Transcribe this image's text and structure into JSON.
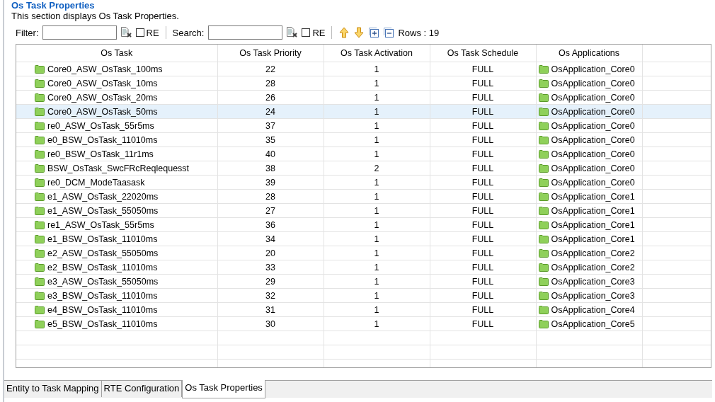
{
  "section": {
    "title": "Os Task Properties",
    "description": "This section displays Os Task Properties."
  },
  "toolbar": {
    "filter_label": "Filter:",
    "filter_re": {
      "label": "RE",
      "checked": false
    },
    "search_label": "Search:",
    "search_re": {
      "label": "RE",
      "checked": false
    },
    "rows": "Rows : 19"
  },
  "table": {
    "columns": [
      "Os Task",
      "Os Task Priority",
      "Os Task Activation",
      "Os Task Schedule",
      "Os Applications"
    ],
    "rows": [
      {
        "task": "Core0_ASW_OsTask_100ms",
        "priority": "22",
        "activation": "1",
        "schedule": "FULL",
        "application": "OsApplication_Core0",
        "selected": false
      },
      {
        "task": "Core0_ASW_OsTask_10ms",
        "priority": "28",
        "activation": "1",
        "schedule": "FULL",
        "application": "OsApplication_Core0",
        "selected": false
      },
      {
        "task": "Core0_ASW_OsTask_20ms",
        "priority": "26",
        "activation": "1",
        "schedule": "FULL",
        "application": "OsApplication_Core0",
        "selected": false
      },
      {
        "task": "Core0_ASW_OsTask_50ms",
        "priority": "24",
        "activation": "1",
        "schedule": "FULL",
        "application": "OsApplication_Core0",
        "selected": true
      },
      {
        "task": "re0_ASW_OsTask_55r5ms",
        "priority": "37",
        "activation": "1",
        "schedule": "FULL",
        "application": "OsApplication_Core0",
        "selected": false
      },
      {
        "task": "e0_BSW_OsTask_11010ms",
        "priority": "35",
        "activation": "1",
        "schedule": "FULL",
        "application": "OsApplication_Core0",
        "selected": false
      },
      {
        "task": "re0_BSW_OsTask_11r1ms",
        "priority": "40",
        "activation": "1",
        "schedule": "FULL",
        "application": "OsApplication_Core0",
        "selected": false
      },
      {
        "task": "BSW_OsTask_SwcFRcReqlequesst",
        "priority": "38",
        "activation": "2",
        "schedule": "FULL",
        "application": "OsApplication_Core0",
        "selected": false
      },
      {
        "task": "re0_DCM_ModeTaasask",
        "priority": "39",
        "activation": "1",
        "schedule": "FULL",
        "application": "OsApplication_Core0",
        "selected": false
      },
      {
        "task": "e1_ASW_OsTask_22020ms",
        "priority": "28",
        "activation": "1",
        "schedule": "FULL",
        "application": "OsApplication_Core1",
        "selected": false
      },
      {
        "task": "e1_ASW_OsTask_55050ms",
        "priority": "27",
        "activation": "1",
        "schedule": "FULL",
        "application": "OsApplication_Core1",
        "selected": false
      },
      {
        "task": "re1_ASW_OsTask_55r5ms",
        "priority": "36",
        "activation": "1",
        "schedule": "FULL",
        "application": "OsApplication_Core1",
        "selected": false
      },
      {
        "task": "e1_BSW_OsTask_11010ms",
        "priority": "34",
        "activation": "1",
        "schedule": "FULL",
        "application": "OsApplication_Core1",
        "selected": false
      },
      {
        "task": "e2_ASW_OsTask_55050ms",
        "priority": "20",
        "activation": "1",
        "schedule": "FULL",
        "application": "OsApplication_Core2",
        "selected": false
      },
      {
        "task": "e2_BSW_OsTask_11010ms",
        "priority": "33",
        "activation": "1",
        "schedule": "FULL",
        "application": "OsApplication_Core2",
        "selected": false
      },
      {
        "task": "e3_ASW_OsTask_55050ms",
        "priority": "29",
        "activation": "1",
        "schedule": "FULL",
        "application": "OsApplication_Core3",
        "selected": false
      },
      {
        "task": "e3_BSW_OsTask_11010ms",
        "priority": "32",
        "activation": "1",
        "schedule": "FULL",
        "application": "OsApplication_Core3",
        "selected": false
      },
      {
        "task": "e4_BSW_OsTask_11010ms",
        "priority": "31",
        "activation": "1",
        "schedule": "FULL",
        "application": "OsApplication_Core4",
        "selected": false
      },
      {
        "task": "e5_BSW_OsTask_11010ms",
        "priority": "30",
        "activation": "1",
        "schedule": "FULL",
        "application": "OsApplication_Core5",
        "selected": false
      }
    ]
  },
  "tabs": [
    {
      "label": "Entity to Task Mapping",
      "selected": false
    },
    {
      "label": "RTE Configuration",
      "selected": false
    },
    {
      "label": "Os Task Properties",
      "selected": true
    }
  ]
}
